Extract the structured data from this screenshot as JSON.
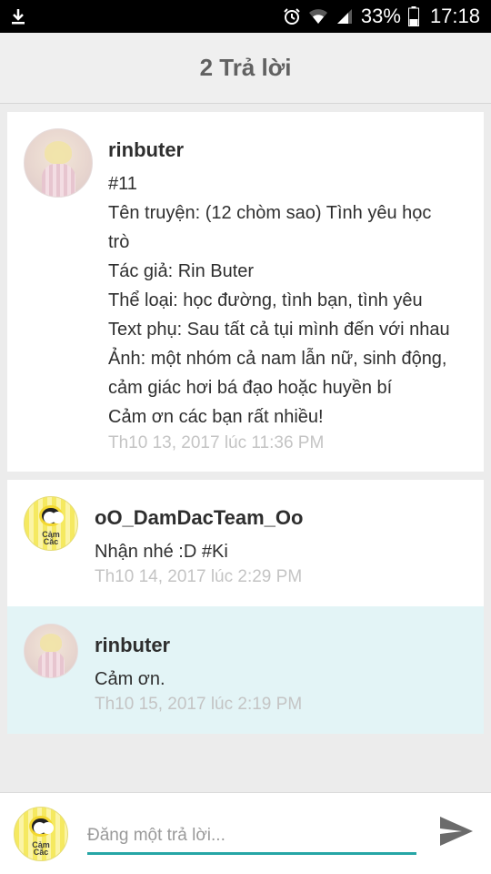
{
  "status_bar": {
    "battery": "33%",
    "time": "17:18",
    "icons": [
      "download-icon",
      "alarm-icon",
      "wifi-icon",
      "signal-icon",
      "battery-icon"
    ]
  },
  "header": {
    "title": "2 Trả lời"
  },
  "topic": {
    "author": "rinbuter",
    "lines": [
      "#11",
      "Tên truyện: (12 chòm sao) Tình yêu học",
      "trò",
      "Tác giả: Rin Buter",
      "Thể loại: học đường, tình bạn, tình yêu",
      "Text phụ: Sau tất cả tụi mình đến với nhau",
      "Ảnh: một nhóm cả nam lẫn nữ, sinh động,",
      "cảm giác hơi bá đạo hoặc huyền bí",
      "Cảm ơn các bạn rất nhiều!"
    ],
    "timestamp": "Th10 13, 2017 lúc 11:36 PM"
  },
  "replies": [
    {
      "author": "oO_DamDacTeam_Oo",
      "text": "Nhận nhé :D #Ki",
      "timestamp": "Th10 14, 2017 lúc 2:29 PM",
      "avatar_text": [
        "Cảm",
        "Cắc"
      ]
    },
    {
      "author": "rinbuter",
      "text": "Cảm ơn.",
      "timestamp": "Th10 15, 2017 lúc 2:19 PM",
      "highlight_color": "#e3f4f6"
    }
  ],
  "composer": {
    "placeholder": "Đăng một trả lời...",
    "value": "",
    "avatar_text": [
      "Cảm",
      "Cắc"
    ],
    "accent_color": "#26a6a6"
  }
}
